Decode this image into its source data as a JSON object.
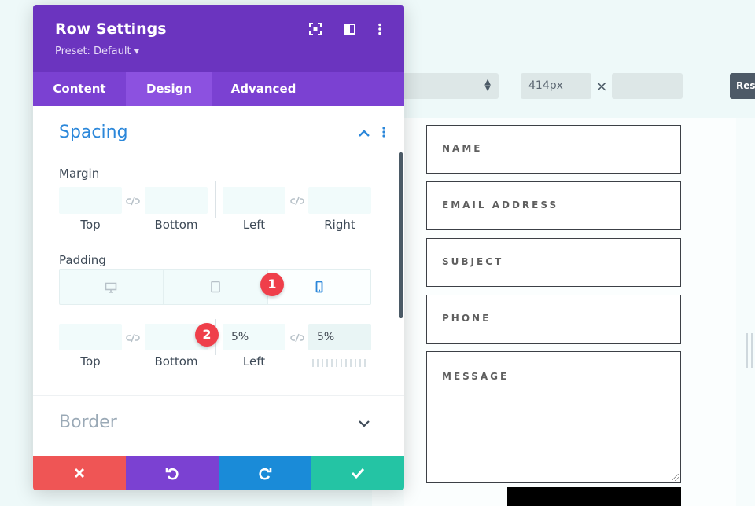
{
  "topbar": {
    "width_value": "414px",
    "times_symbol": "×",
    "reset_label": "Res"
  },
  "contact_form": {
    "fields": [
      {
        "label": "NAME"
      },
      {
        "label": "EMAIL ADDRESS"
      },
      {
        "label": "SUBJECT"
      },
      {
        "label": "PHONE"
      },
      {
        "label": "MESSAGE"
      }
    ]
  },
  "panel": {
    "title": "Row Settings",
    "preset": "Preset: Default ▾",
    "tabs": [
      "Content",
      "Design",
      "Advanced"
    ],
    "active_tab": "Design",
    "header_icons": [
      "fullscreen-icon",
      "sidebar-toggle-icon",
      "more-options-icon"
    ],
    "spacing": {
      "title": "Spacing",
      "margin": {
        "label": "Margin",
        "fields": [
          {
            "label": "Top",
            "value": ""
          },
          {
            "label": "Bottom",
            "value": ""
          },
          {
            "label": "Left",
            "value": ""
          },
          {
            "label": "Right",
            "value": ""
          }
        ]
      },
      "padding": {
        "label": "Padding",
        "devices": [
          "desktop-icon",
          "tablet-icon",
          "phone-icon"
        ],
        "active_device": "phone",
        "fields": [
          {
            "label": "Top",
            "value": ""
          },
          {
            "label": "Bottom",
            "value": ""
          },
          {
            "label": "Left",
            "value": "5%"
          },
          {
            "label": "Right",
            "value": "5%"
          }
        ]
      }
    },
    "border": {
      "title": "Border"
    },
    "annotations": [
      "1",
      "2"
    ],
    "actions": [
      {
        "name": "discard",
        "icon": "close-icon",
        "color": "#ef5555"
      },
      {
        "name": "undo",
        "icon": "undo-icon",
        "color": "#7b41d2"
      },
      {
        "name": "redo",
        "icon": "redo-icon",
        "color": "#1a8bd8"
      },
      {
        "name": "save",
        "icon": "check-icon",
        "color": "#24c4a4"
      }
    ]
  },
  "colors": {
    "header_purple": "#6b34bf",
    "tab_purple": "#7b41d2",
    "section_blue": "#2b87da",
    "badge_red": "#ef3f4a"
  }
}
